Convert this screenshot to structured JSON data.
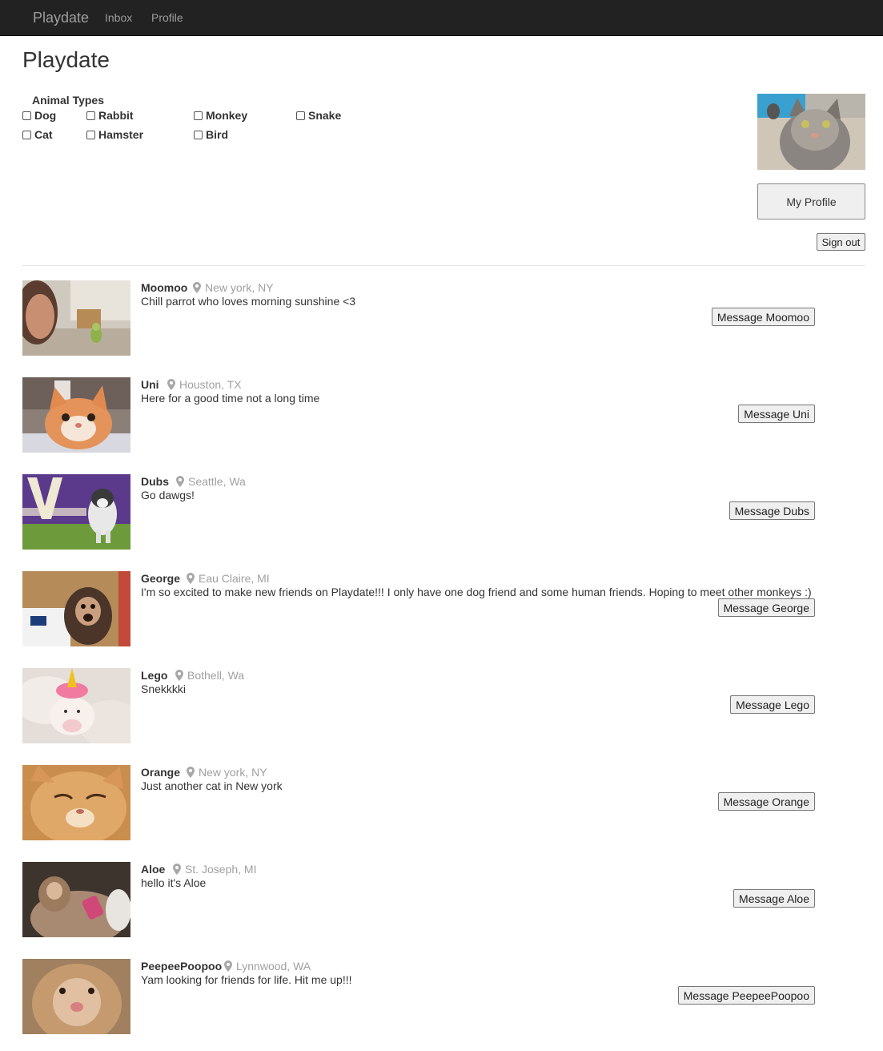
{
  "navbar": {
    "brand": "Playdate",
    "links": [
      "Inbox",
      "Profile"
    ]
  },
  "page_title": "Playdate",
  "filter": {
    "legend": "Animal Types",
    "options": [
      "Dog",
      "Rabbit",
      "Monkey",
      "Snake",
      "Cat",
      "Hamster",
      "Bird"
    ],
    "checked": [
      false,
      false,
      false,
      false,
      false,
      false,
      false
    ]
  },
  "profile_panel": {
    "my_profile_label": "My Profile",
    "sign_out_label": "Sign out"
  },
  "pets": [
    {
      "name": "Moomoo",
      "location": "New york, NY",
      "description": "Chill parrot who loves morning sunshine <3",
      "button": "Message Moomoo"
    },
    {
      "name": "Uni",
      "location": "Houston, TX",
      "description": "Here for a good time not a long time",
      "button": "Message Uni"
    },
    {
      "name": "Dubs",
      "location": "Seattle, Wa",
      "description": "Go dawgs!",
      "button": "Message Dubs"
    },
    {
      "name": "George",
      "location": "Eau Claire, MI",
      "description": "I'm so excited to make new friends on Playdate!!! I only have one dog friend and some human friends. Hoping to meet other monkeys :)",
      "button": "Message George"
    },
    {
      "name": "Lego",
      "location": "Bothell, Wa",
      "description": "Snekkkki",
      "button": "Message Lego"
    },
    {
      "name": "Orange",
      "location": "New york, NY",
      "description": "Just another cat in New york",
      "button": "Message Orange"
    },
    {
      "name": "Aloe",
      "location": "St. Joseph, MI",
      "description": "hello it's Aloe",
      "button": "Message Aloe"
    },
    {
      "name": "PeepeePoopoo",
      "location": "Lynnwood, WA",
      "description": "Yam looking for friends for life. Hit me up!!!",
      "button": "Message PeepeePoopoo"
    }
  ],
  "colors": {
    "navbar_bg": "#222222",
    "navbar_text": "#9d9d9d",
    "location_text": "#a0a0a0",
    "button_bg": "#efefef"
  }
}
